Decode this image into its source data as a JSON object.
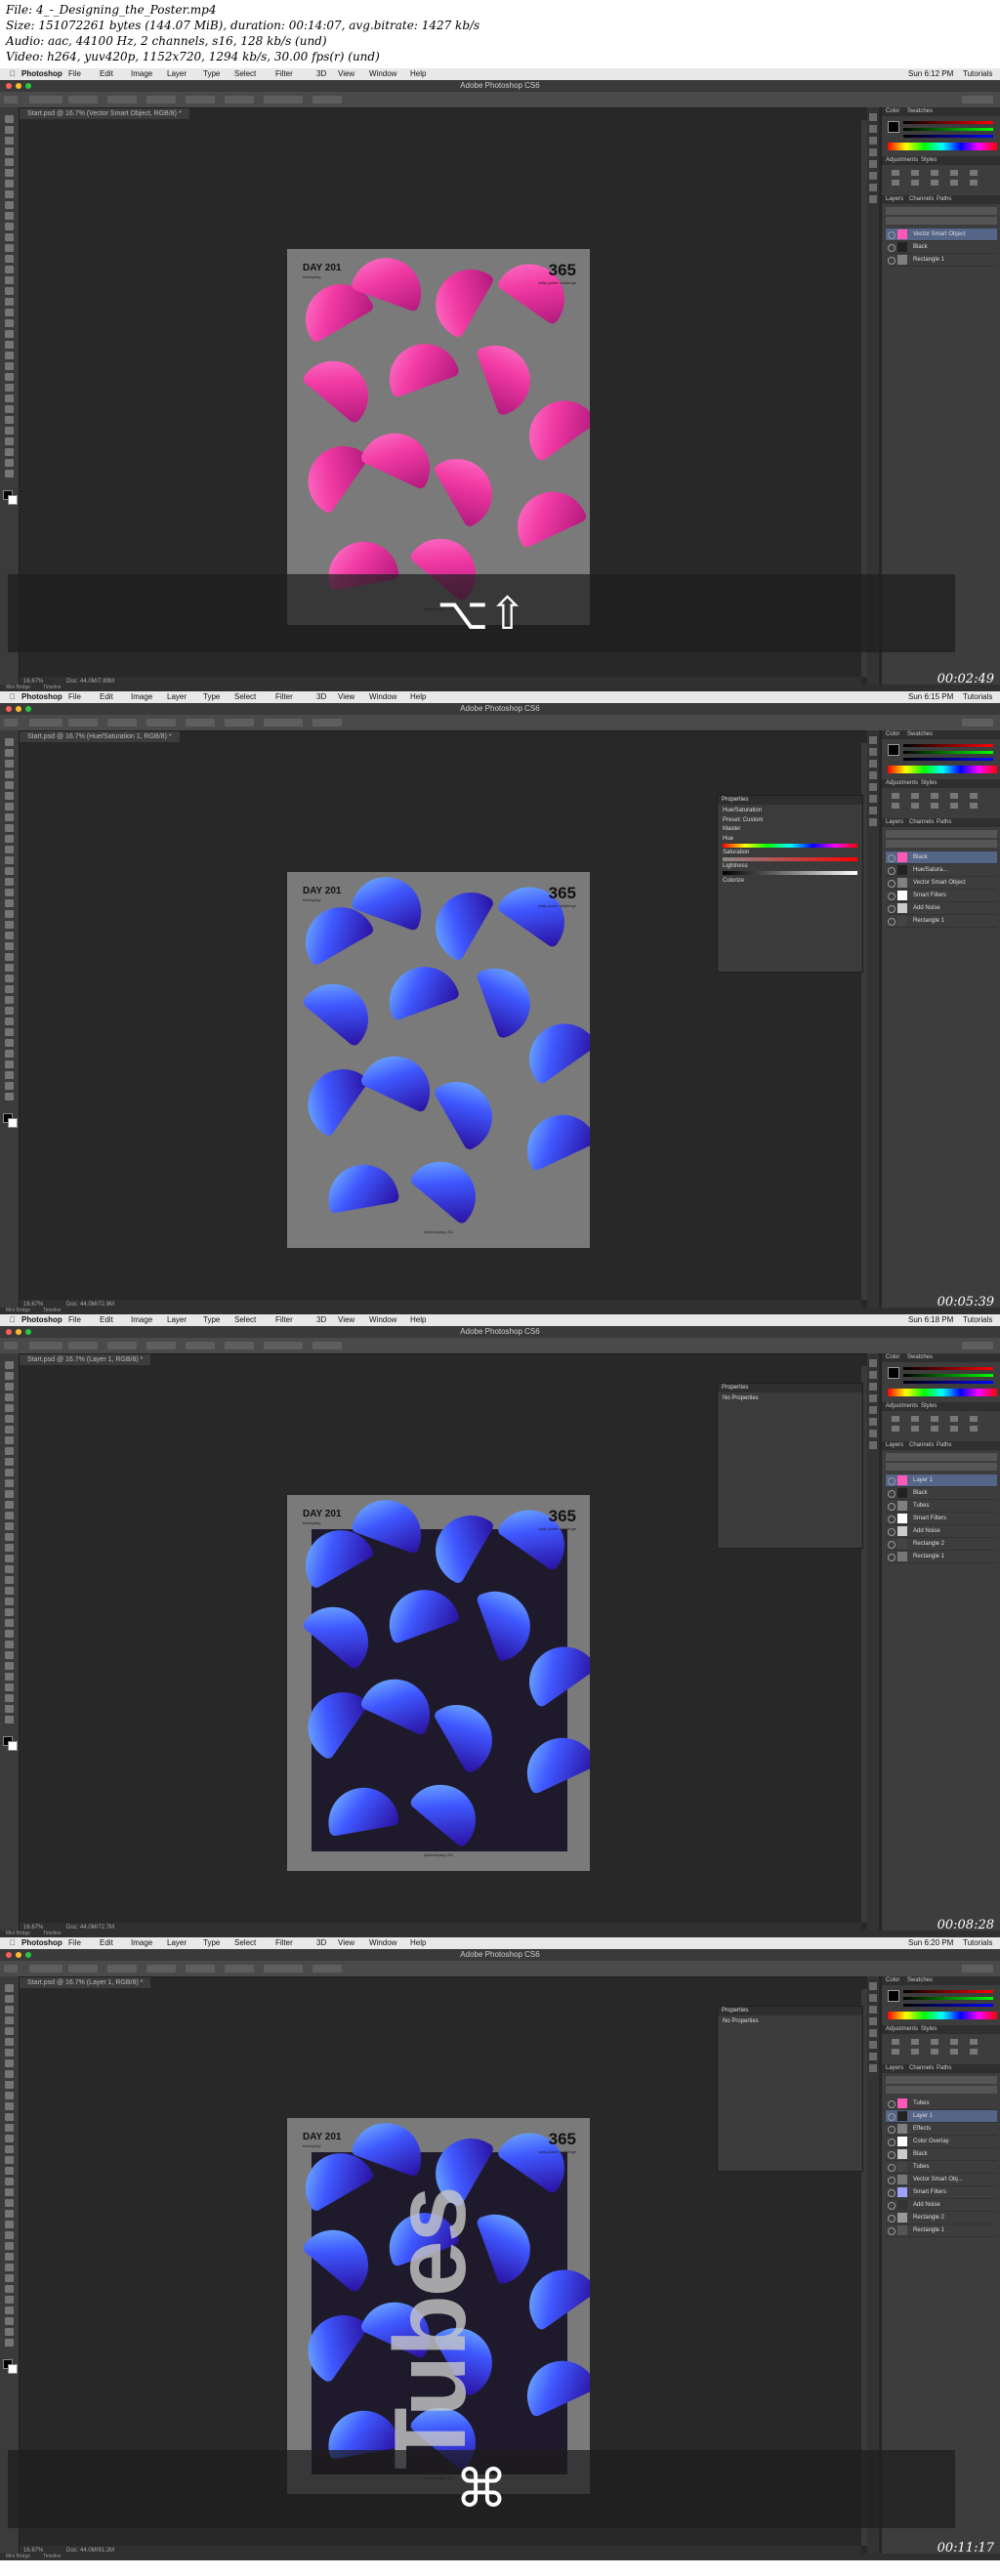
{
  "file_info": {
    "line1": "File: 4_-_Designing_the_Poster.mp4",
    "line2": "Size: 151072261 bytes (144.07 MiB), duration: 00:14:07, avg.bitrate: 1427 kb/s",
    "line3": "Audio: aac, 44100 Hz, 2 channels, s16, 128 kb/s (und)",
    "line4": "Video: h264, yuv420p, 1152x720, 1294 kb/s, 30.00 fps(r) (und)"
  },
  "menu": {
    "app": "Photoshop",
    "items": [
      "File",
      "Edit",
      "Image",
      "Layer",
      "Type",
      "Select",
      "Filter",
      "3D",
      "View",
      "Window",
      "Help"
    ],
    "tutorials": "Tutorials"
  },
  "window_title": "Adobe Photoshop CS6",
  "colors": {
    "pink": "#f23aa4",
    "blue": "#3f58ff",
    "selected_layer": "#546588",
    "poster_gray": "#7a7a7a",
    "dark_rect": "#1f1a2b"
  },
  "poster": {
    "day": "DAY 201",
    "day_sub": "tubebyday",
    "number": "365",
    "number_sub": "daily poster challenge",
    "footer": "@tubebyday 201"
  },
  "frames": [
    {
      "clock": "Sun 6:12 PM",
      "doc_tab": "Start.psd @ 16.7% (Vector Smart Object, RGB/8) *",
      "status_zoom": "16.67%",
      "status_doc": "Doc: 44.0M/7.89M",
      "timestamp": "00:02:49",
      "overlay_keys": "⌥⇧",
      "layers": [
        "Vector Smart Object",
        "Black",
        "Rectangle 1"
      ],
      "properties": null
    },
    {
      "clock": "Sun 6:15 PM",
      "doc_tab": "Start.psd @ 16.7% (Hue/Saturation 1, RGB/8) *",
      "status_zoom": "16.67%",
      "status_doc": "Doc: 44.0M/72.9M",
      "timestamp": "00:05:39",
      "overlay_keys": "",
      "layers": [
        "Black",
        "Hue/Satura...",
        "Vector Smart Object",
        "Smart Filters",
        "Add Noise",
        "Rectangle 1"
      ],
      "properties": {
        "title": "Hue/Saturation",
        "preset": "Preset: Custom",
        "channel": "Master",
        "hue": "Hue",
        "saturation": "Saturation",
        "lightness": "Lightness",
        "colorize": "Colorize"
      }
    },
    {
      "clock": "Sun 6:18 PM",
      "doc_tab": "Start.psd @ 16.7% (Layer 1, RGB/8) *",
      "status_zoom": "16.67%",
      "status_doc": "Doc: 44.0M/72.7M",
      "timestamp": "00:08:28",
      "overlay_keys": "",
      "layers": [
        "Layer 1",
        "Black",
        "Tubes",
        "Smart Filters",
        "Add Noise",
        "Rectangle 2",
        "Rectangle 1"
      ],
      "properties": {
        "title": "No Properties"
      }
    },
    {
      "clock": "Sun 6:20 PM",
      "doc_tab": "Start.psd @ 16.7% (Layer 1, RGB/8) *",
      "status_zoom": "16.67%",
      "status_doc": "Doc: 44.0M/91.2M",
      "timestamp": "00:11:17",
      "overlay_keys": "⌘",
      "big_text": "Tubes",
      "layers": [
        "Tubes",
        "Layer 1",
        "Effects",
        "Color Overlay",
        "Black",
        "Tubes",
        "Vector Smart Obj...",
        "Smart Filters",
        "Add Noise",
        "Rectangle 2",
        "Rectangle 1"
      ],
      "properties": {
        "title": "No Properties"
      }
    }
  ]
}
